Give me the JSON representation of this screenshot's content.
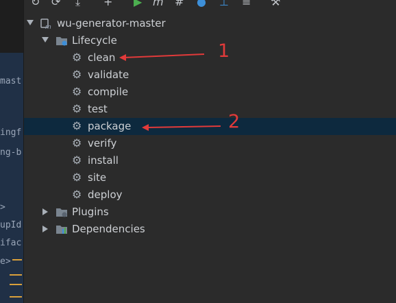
{
  "editor": {
    "code_lines": [
      "mast",
      "ingf",
      "ng-b",
      ">",
      "upId",
      "ifac",
      "e>"
    ]
  },
  "toolbar": {
    "icons": [
      "refresh-icon",
      "reimport-icon",
      "download-icon",
      "add-icon",
      "run-icon",
      "maven-goal-icon",
      "toggle-offline-icon",
      "skip-tests-icon",
      "show-dependencies-icon",
      "collapse-all-icon",
      "settings-wrench-icon"
    ]
  },
  "tree": {
    "root": "wu-generator-master",
    "lifecycle": "Lifecycle",
    "goals": [
      "clean",
      "validate",
      "compile",
      "test",
      "package",
      "verify",
      "install",
      "site",
      "deploy"
    ],
    "selected": "package",
    "plugins": "Plugins",
    "dependencies": "Dependencies"
  },
  "annotations": {
    "one": "1",
    "two": "2",
    "color": "#e23a3a"
  },
  "colors": {
    "background": "#2b2b2b",
    "selection": "#0d293e",
    "text": "#cdd0d4"
  }
}
